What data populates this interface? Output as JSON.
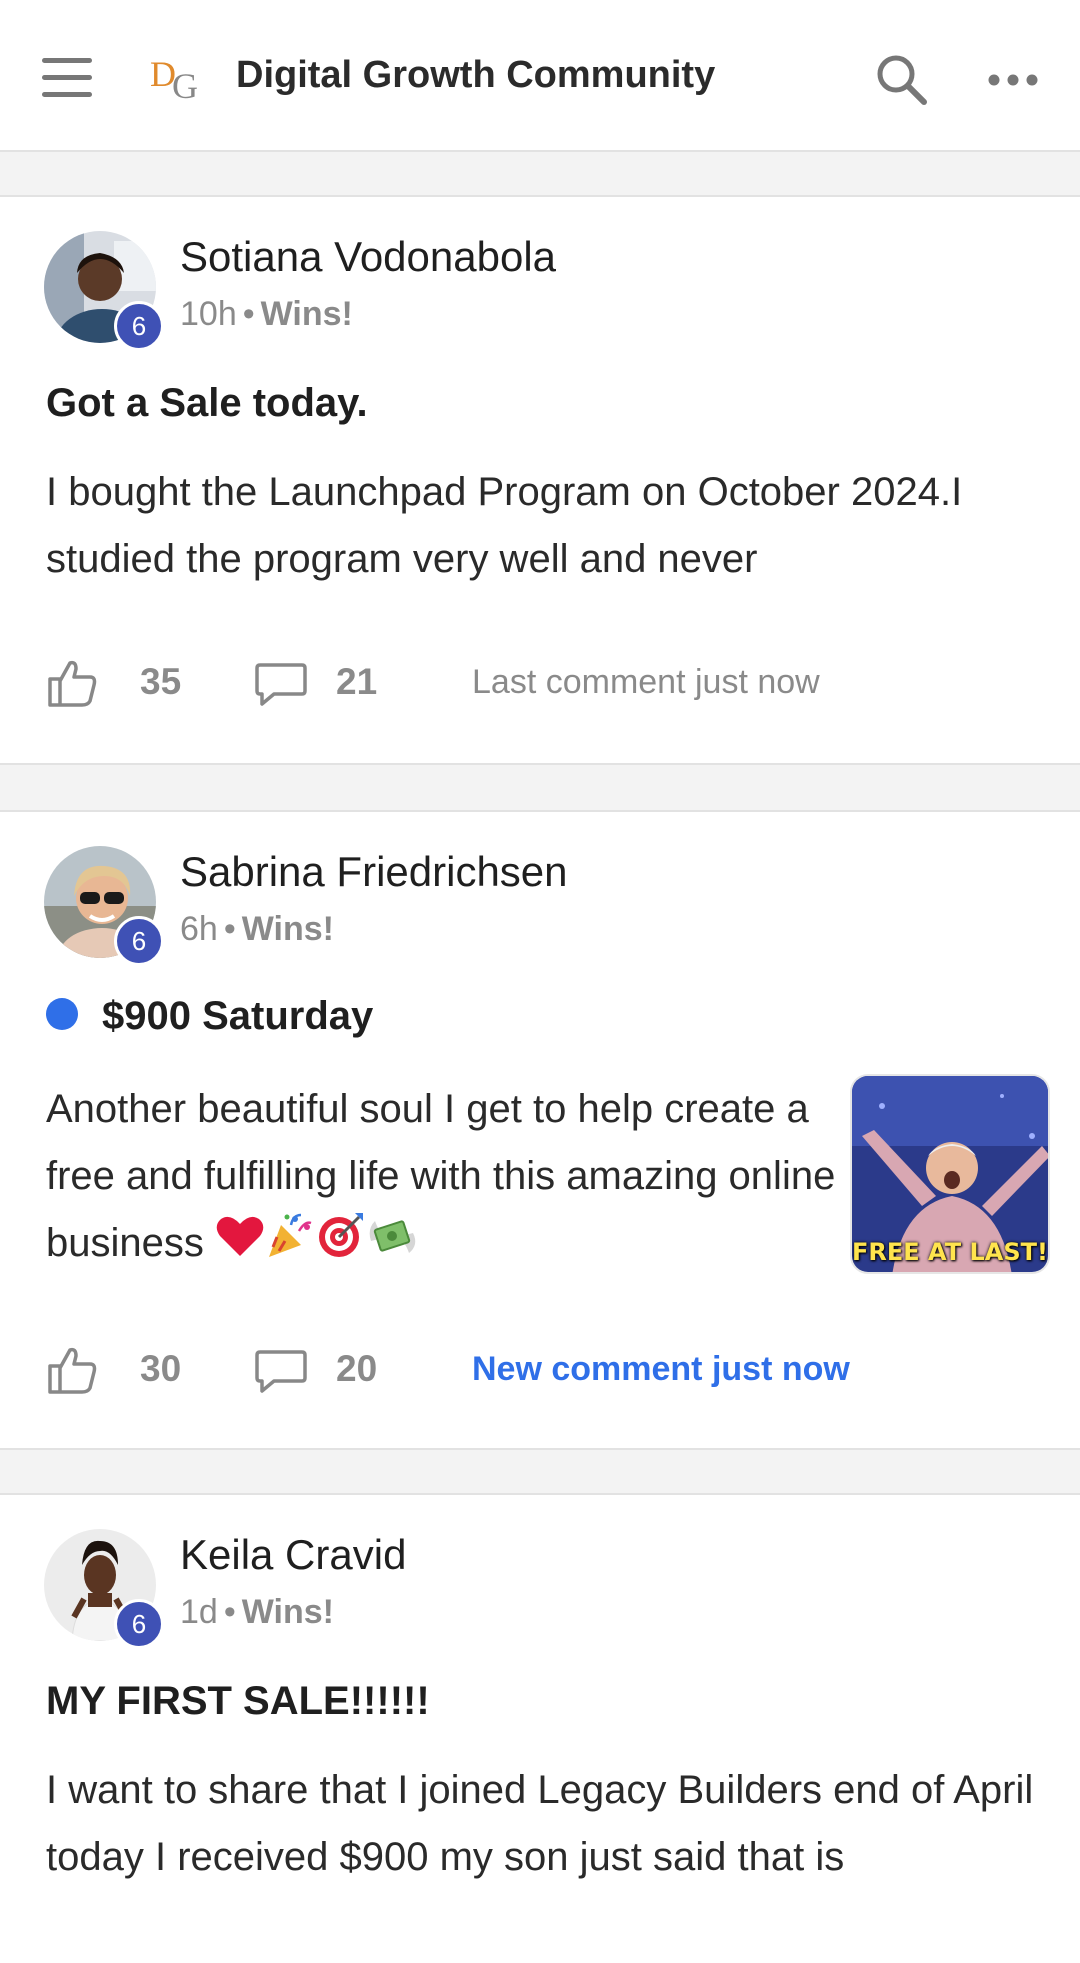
{
  "app": {
    "title": "Digital Growth Community",
    "logo_text": "DG",
    "accent_color": "#2f6fe8",
    "badge_color": "#3f51b5"
  },
  "header": {
    "menu_icon": "hamburger-menu-icon",
    "search_icon": "search-icon",
    "more_icon": "more-horizontal-icon"
  },
  "posts": [
    {
      "author": "Sotiana Vodonabola",
      "level": "6",
      "time": "10h",
      "category": "Wins!",
      "title": "Got a Sale today.",
      "body": "I bought the Launchpad Program on October 2024.I studied the program very well and never",
      "likes": "35",
      "comments": "21",
      "last_comment": "Last comment just now",
      "unread": false
    },
    {
      "author": "Sabrina Friedrichsen",
      "level": "6",
      "time": "6h",
      "category": "Wins!",
      "title": "$900 Saturday",
      "body": "Another beautiful soul I get to help create a free and fulfilling life with this amazing online business",
      "body_emojis": [
        "red-heart",
        "party-popper",
        "direct-hit",
        "money-with-wings"
      ],
      "thumbnail_caption": "FREE AT LAST!",
      "likes": "30",
      "comments": "20",
      "last_comment": "New comment just now",
      "unread": true
    },
    {
      "author": "Keila Cravid",
      "level": "6",
      "time": "1d",
      "category": "Wins!",
      "title": "MY FIRST SALE!!!!!!",
      "body": "I want to share that I joined Legacy Builders end of April today I received $900 my son just said that is",
      "unread": false
    }
  ]
}
